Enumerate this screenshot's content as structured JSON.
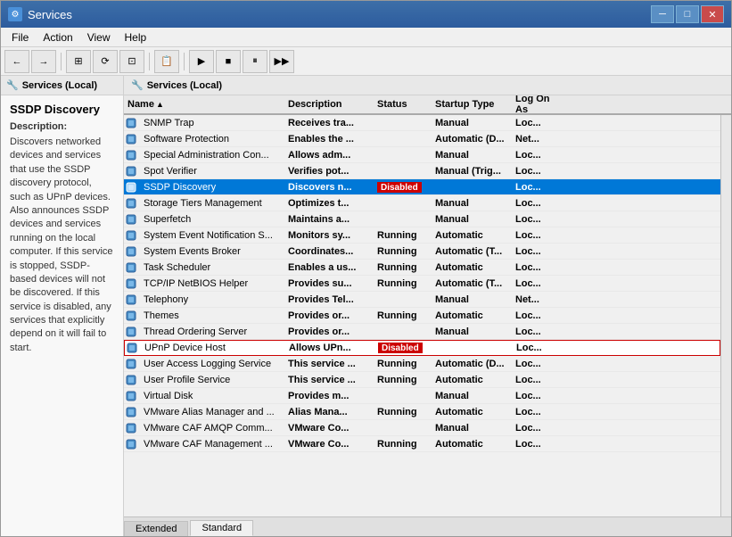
{
  "window": {
    "title": "Services",
    "icon": "⚙"
  },
  "titleControls": {
    "minimize": "─",
    "maximize": "□",
    "close": "✕"
  },
  "menu": {
    "items": [
      "File",
      "Action",
      "View",
      "Help"
    ]
  },
  "toolbar": {
    "buttons": [
      "←",
      "→",
      "⊞",
      "⟳",
      "⊡",
      "▶",
      "■",
      "⏸",
      "▶▶"
    ]
  },
  "leftPanel": {
    "header": "Services (Local)",
    "selectedService": {
      "name": "SSDP Discovery",
      "descLabel": "Description:",
      "description": "Discovers networked devices and services that use the SSDP discovery protocol, such as UPnP devices. Also announces SSDP devices and services running on the local computer. If this service is stopped, SSDP-based devices will not be discovered. If this service is disabled, any services that explicitly depend on it will fail to start."
    }
  },
  "rightPanel": {
    "header": "Services (Local)"
  },
  "tableColumns": {
    "name": "Name",
    "description": "Description",
    "status": "Status",
    "startupType": "Startup Type",
    "logOn": "Log On As"
  },
  "services": [
    {
      "name": "SNMP Trap",
      "description": "Receives tra...",
      "status": "",
      "startupType": "Manual",
      "logOn": "Loc..."
    },
    {
      "name": "Software Protection",
      "description": "Enables the ...",
      "status": "",
      "startupType": "Automatic (D...",
      "logOn": "Net..."
    },
    {
      "name": "Special Administration Con...",
      "description": "Allows adm...",
      "status": "",
      "startupType": "Manual",
      "logOn": "Loc..."
    },
    {
      "name": "Spot Verifier",
      "description": "Verifies pot...",
      "status": "",
      "startupType": "Manual (Trig...",
      "logOn": "Loc..."
    },
    {
      "name": "SSDP Discovery",
      "description": "Discovers n...",
      "status": "Disabled",
      "startupType": "",
      "logOn": "Loc...",
      "selected": true
    },
    {
      "name": "Storage Tiers Management",
      "description": "Optimizes t...",
      "status": "",
      "startupType": "Manual",
      "logOn": "Loc..."
    },
    {
      "name": "Superfetch",
      "description": "Maintains a...",
      "status": "",
      "startupType": "Manual",
      "logOn": "Loc..."
    },
    {
      "name": "System Event Notification S...",
      "description": "Monitors sy...",
      "status": "Running",
      "startupType": "Automatic",
      "logOn": "Loc..."
    },
    {
      "name": "System Events Broker",
      "description": "Coordinates...",
      "status": "Running",
      "startupType": "Automatic (T...",
      "logOn": "Loc..."
    },
    {
      "name": "Task Scheduler",
      "description": "Enables a us...",
      "status": "Running",
      "startupType": "Automatic",
      "logOn": "Loc..."
    },
    {
      "name": "TCP/IP NetBIOS Helper",
      "description": "Provides su...",
      "status": "Running",
      "startupType": "Automatic (T...",
      "logOn": "Loc..."
    },
    {
      "name": "Telephony",
      "description": "Provides Tel...",
      "status": "",
      "startupType": "Manual",
      "logOn": "Net..."
    },
    {
      "name": "Themes",
      "description": "Provides or...",
      "status": "Running",
      "startupType": "Automatic",
      "logOn": "Loc..."
    },
    {
      "name": "Thread Ordering Server",
      "description": "Provides or...",
      "status": "",
      "startupType": "Manual",
      "logOn": "Loc..."
    },
    {
      "name": "UPnP Device Host",
      "description": "Allows UPn...",
      "status": "Disabled",
      "startupType": "",
      "logOn": "Loc...",
      "highlighted": true
    },
    {
      "name": "User Access Logging Service",
      "description": "This service ...",
      "status": "Running",
      "startupType": "Automatic (D...",
      "logOn": "Loc..."
    },
    {
      "name": "User Profile Service",
      "description": "This service ...",
      "status": "Running",
      "startupType": "Automatic",
      "logOn": "Loc..."
    },
    {
      "name": "Virtual Disk",
      "description": "Provides m...",
      "status": "",
      "startupType": "Manual",
      "logOn": "Loc..."
    },
    {
      "name": "VMware Alias Manager and ...",
      "description": "Alias Mana...",
      "status": "Running",
      "startupType": "Automatic",
      "logOn": "Loc..."
    },
    {
      "name": "VMware CAF AMQP Comm...",
      "description": "VMware Co...",
      "status": "",
      "startupType": "Manual",
      "logOn": "Loc..."
    },
    {
      "name": "VMware CAF Management ...",
      "description": "VMware Co...",
      "status": "Running",
      "startupType": "Automatic",
      "logOn": "Loc..."
    }
  ],
  "tabs": {
    "extended": "Extended",
    "standard": "Standard"
  }
}
